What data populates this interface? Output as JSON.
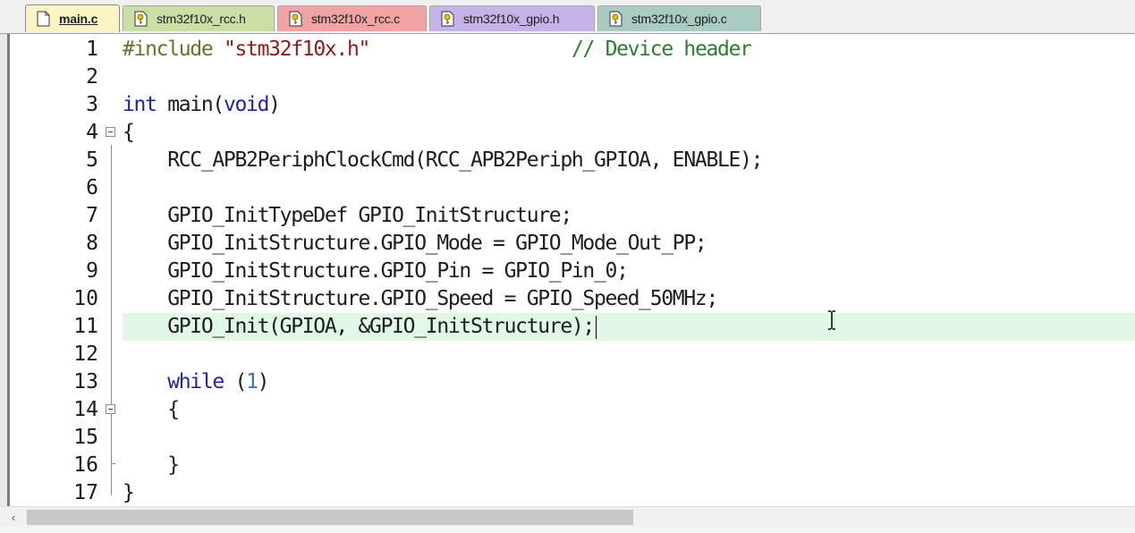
{
  "tabs": [
    {
      "label": "main.c",
      "active": true,
      "color": "#fbf3c4",
      "icon": "doc-icon"
    },
    {
      "label": "stm32f10x_rcc.h",
      "active": false,
      "color": "#c9dfa6",
      "icon": "header-file-key-icon"
    },
    {
      "label": "stm32f10x_rcc.c",
      "active": false,
      "color": "#f2a3a3",
      "icon": "source-file-key-icon"
    },
    {
      "label": "stm32f10x_gpio.h",
      "active": false,
      "color": "#c6b3e8",
      "icon": "header-file-key-icon"
    },
    {
      "label": "stm32f10x_gpio.c",
      "active": false,
      "color": "#a9cbc3",
      "icon": "source-file-key-icon"
    }
  ],
  "editor": {
    "current_line": 11,
    "lines": [
      {
        "num": "1",
        "text": "#include \"stm32f10x.h\"                  // Device header"
      },
      {
        "num": "2",
        "text": ""
      },
      {
        "num": "3",
        "text": "int main(void)"
      },
      {
        "num": "4",
        "text": "{"
      },
      {
        "num": "5",
        "text": "    RCC_APB2PeriphClockCmd(RCC_APB2Periph_GPIOA, ENABLE);"
      },
      {
        "num": "6",
        "text": ""
      },
      {
        "num": "7",
        "text": "    GPIO_InitTypeDef GPIO_InitStructure;"
      },
      {
        "num": "8",
        "text": "    GPIO_InitStructure.GPIO_Mode = GPIO_Mode_Out_PP;"
      },
      {
        "num": "9",
        "text": "    GPIO_InitStructure.GPIO_Pin = GPIO_Pin_0;"
      },
      {
        "num": "10",
        "text": "    GPIO_InitStructure.GPIO_Speed = GPIO_Speed_50MHz;"
      },
      {
        "num": "11",
        "text": "    GPIO_Init(GPIOA, &GPIO_InitStructure);"
      },
      {
        "num": "12",
        "text": ""
      },
      {
        "num": "13",
        "text": "    while (1)"
      },
      {
        "num": "14",
        "text": "    {"
      },
      {
        "num": "15",
        "text": ""
      },
      {
        "num": "16",
        "text": "    }"
      },
      {
        "num": "17",
        "text": "}"
      }
    ]
  },
  "colors": {
    "current_line_highlight": "#e2f8e6",
    "keyword": "#2323a0",
    "preprocessor": "#6e6e2e",
    "string": "#8c1b1b",
    "comment": "#2e7d2e",
    "number": "#3a7a9a"
  },
  "scrollbar": {
    "left_arrow": "‹"
  }
}
